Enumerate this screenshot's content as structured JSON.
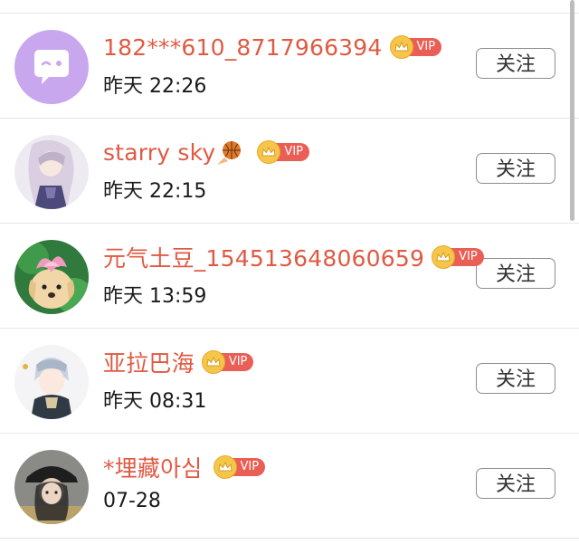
{
  "follow_list": {
    "items": [
      {
        "name": "182***610_8717966394",
        "vip": "VIP",
        "time": "昨天 22:26",
        "follow_label": "关注",
        "avatar_icon": "chat-bubble-face-icon",
        "avatar_color": "#c9a7ef"
      },
      {
        "name": "starry sky",
        "vip": "VIP",
        "time": "昨天 22:15",
        "follow_label": "关注",
        "emoji_icon": "basketball-fire-icon"
      },
      {
        "name": "元气土豆_154513648060659",
        "vip": "VIP",
        "time": "昨天 13:59",
        "follow_label": "关注"
      },
      {
        "name": "亚拉巴海",
        "vip": "VIP",
        "time": "昨天 08:31",
        "follow_label": "关注"
      },
      {
        "name": "*埋藏아심",
        "vip": "VIP",
        "time": "07-28",
        "follow_label": "关注"
      }
    ]
  },
  "colors": {
    "name": "#e05a43",
    "vip_tag": "#e95f55",
    "crown": "#f6c64a",
    "divider": "#e6e6e6"
  }
}
